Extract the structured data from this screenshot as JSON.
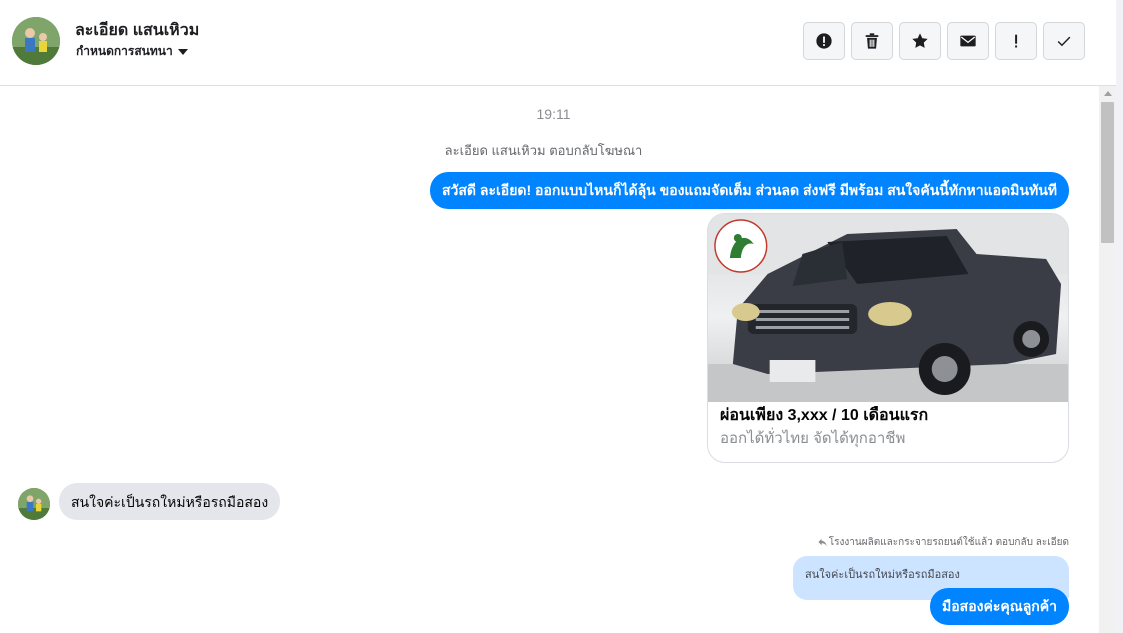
{
  "header": {
    "contact_name": "ละเอียด แสนเหิวม",
    "conversation_menu_label": "กำหนดการสนทนา",
    "actions": [
      {
        "name": "report-spam-button",
        "icon": "alert-circle-icon"
      },
      {
        "name": "delete-button",
        "icon": "trash-icon"
      },
      {
        "name": "star-button",
        "icon": "star-icon"
      },
      {
        "name": "mark-unread-button",
        "icon": "envelope-icon"
      },
      {
        "name": "follow-up-button",
        "icon": "exclamation-icon"
      },
      {
        "name": "mark-done-button",
        "icon": "checkmark-icon"
      }
    ]
  },
  "thread": {
    "timestamp": "19:11",
    "ad_reply_note": "ละเอียด แสนเหิวม ตอบกลับโฆษณา",
    "outgoing_greeting": "สวัสดี ละเอียด! ออกแบบไหนก็ได้ลุ้น ของแถมจัดเต็ม ส่วนลด ส่งฟรี มีพร้อม สนใจคันนี้ทักหาแอดมินทันที",
    "ad_card": {
      "title": "ผ่อนเพียง 3,xxx / 10 เดือนแรก",
      "subtitle": "ออกได้ทั่วไทย จัดได้ทุกอาชีพ",
      "image_icon": "pickup-truck-photo"
    },
    "incoming_message": "สนใจค่ะเป็นรถใหม่หรือรถมือสอง",
    "reply_note": "โรงงานผลิตและกระจายรถยนต์ใช้แล้ว ตอบกลับ ละเอียด",
    "quoted_message": "สนใจค่ะเป็นรถใหม่หรือรถมือสอง",
    "outgoing_reply": "มือสองค่ะคุณลูกค้า"
  },
  "colors": {
    "outgoing_bubble": "#0084ff",
    "incoming_bubble": "#e4e6eb",
    "quoted_bubble": "#cce4ff"
  }
}
